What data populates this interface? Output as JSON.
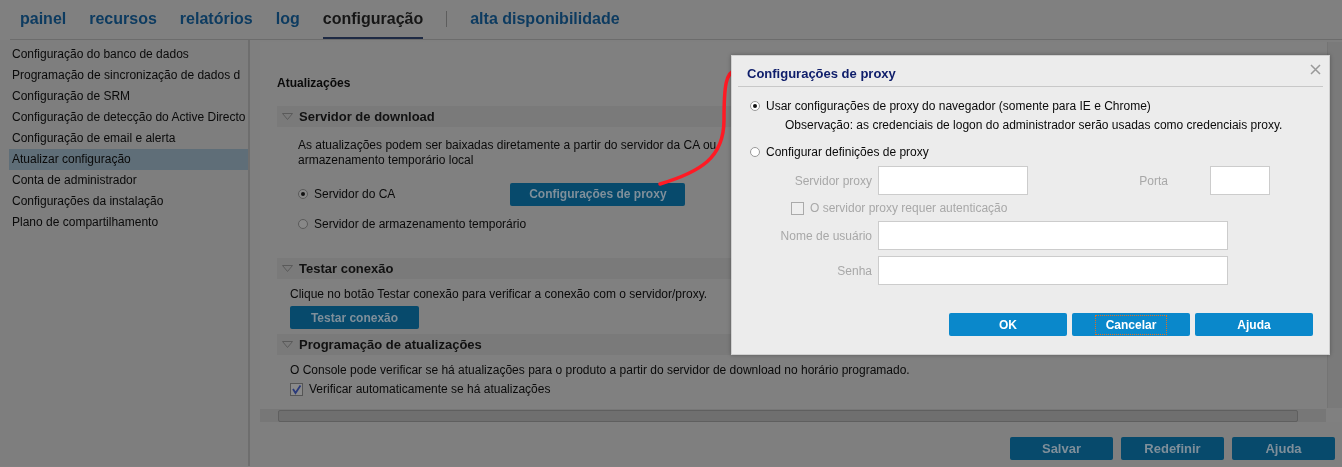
{
  "tabs": [
    {
      "label": "painel",
      "selected": false
    },
    {
      "label": "recursos",
      "selected": false
    },
    {
      "label": "relatórios",
      "selected": false
    },
    {
      "label": "log",
      "selected": false
    },
    {
      "label": "configuração",
      "selected": true
    },
    {
      "label": "alta disponibilidade",
      "selected": false
    }
  ],
  "sidebar": {
    "items": [
      {
        "label": "Configuração do banco de dados",
        "selected": false
      },
      {
        "label": "Programação de sincronização de dados d",
        "selected": false
      },
      {
        "label": "Configuração de SRM",
        "selected": false
      },
      {
        "label": "Configuração de detecção do Active Directo",
        "selected": false
      },
      {
        "label": "Configuração de email e alerta",
        "selected": false
      },
      {
        "label": "Atualizar configuração",
        "selected": true
      },
      {
        "label": "Conta de administrador",
        "selected": false
      },
      {
        "label": "Configurações da instalação",
        "selected": false
      },
      {
        "label": "Plano de compartilhamento",
        "selected": false
      }
    ]
  },
  "content": {
    "title": "Atualizações",
    "download_server": {
      "header": "Servidor de download",
      "description": [
        "As atualizações podem ser baixadas diretamente a partir do servidor da CA ou",
        "armazenamento temporário local"
      ],
      "options": [
        {
          "label": "Servidor do CA",
          "selected": true
        },
        {
          "label": "Servidor de armazenamento temporário",
          "selected": false
        }
      ],
      "proxy_button": "Configurações de proxy"
    },
    "test_connection": {
      "header": "Testar conexão",
      "description": "Clique no botão Testar conexão para verificar a conexão com o servidor/proxy.",
      "button": "Testar conexão"
    },
    "update_schedule": {
      "header": "Programação de atualizações",
      "description": "O Console pode verificar se há atualizações para o produto a partir do servidor de download no horário programado.",
      "auto_check": {
        "label": "Verificar automaticamente se há atualizações",
        "checked": true
      }
    }
  },
  "footer_buttons": [
    "Salvar",
    "Redefinir",
    "Ajuda"
  ],
  "dialog": {
    "title": "Configurações de proxy",
    "options": [
      {
        "label": "Usar configurações de proxy do navegador (somente para IE e Chrome)",
        "selected": true,
        "note": "Observação: as credenciais de logon do administrador serão usadas como credenciais proxy."
      },
      {
        "label": "Configurar definições de proxy",
        "selected": false
      }
    ],
    "proxy_settings": {
      "disabled": true,
      "server_label": "Servidor proxy",
      "port_label": "Porta",
      "auth": {
        "label": "O servidor proxy requer autenticação",
        "checked": false
      },
      "username_label": "Nome de usuário",
      "password_label": "Senha"
    },
    "buttons": [
      {
        "label": "OK",
        "focused": false
      },
      {
        "label": "Cancelar",
        "focused": true
      },
      {
        "label": "Ajuda",
        "focused": false
      }
    ]
  }
}
